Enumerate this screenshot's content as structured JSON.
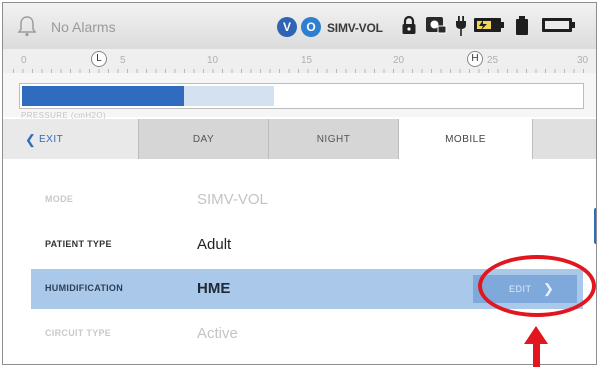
{
  "status_bar": {
    "alarm_text": "No Alarms",
    "badge_v": "V",
    "badge_o": "O",
    "mode": "SIMV-VOL",
    "icons": [
      "bell-icon",
      "lock-icon",
      "screen-lock-icon",
      "plug-icon",
      "battery-icon",
      "battery-small-icon",
      "battery-full-icon"
    ]
  },
  "scale": {
    "numbers": [
      "0",
      "5",
      "10",
      "15",
      "20",
      "25",
      "30"
    ],
    "marker_left": "L",
    "marker_right": "H"
  },
  "pressure": {
    "label": "PRESSURE (cmH2O)",
    "fill_fraction": 0.29,
    "ghost_fraction": 0.16,
    "fill_color": "#2f6bbf",
    "ghost_color": "#d4e1f1"
  },
  "tabs": {
    "exit": "EXIT",
    "day": "DAY",
    "night": "NIGHT",
    "mobile": "MOBILE",
    "active": "MOBILE"
  },
  "rows": [
    {
      "label": "MODE",
      "value": "SIMV-VOL",
      "state": "disabled"
    },
    {
      "label": "PATIENT TYPE",
      "value": "Adult",
      "state": "normal"
    },
    {
      "label": "HUMIDIFICATION",
      "value": "HME",
      "state": "selected",
      "action": "EDIT"
    },
    {
      "label": "CIRCUIT TYPE",
      "value": "Active",
      "state": "disabled"
    }
  ],
  "colors": {
    "accent": "#2f6bbf",
    "selected_row": "#a9c8ea",
    "annotation": "#e2161f"
  }
}
